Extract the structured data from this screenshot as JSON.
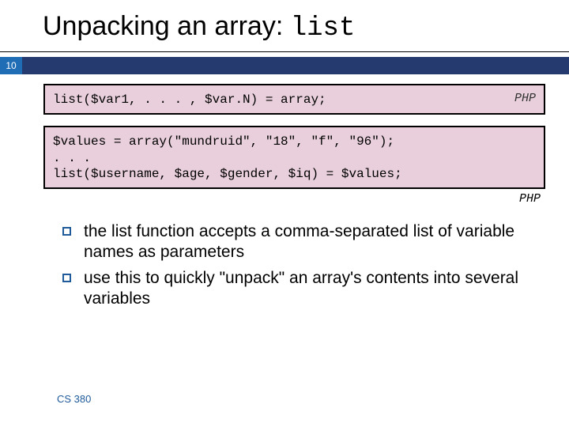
{
  "slide": {
    "title_plain": "Unpacking an array: ",
    "title_code": "list",
    "page_number": "10"
  },
  "code1": {
    "text": "list($var1, . . . , $var.N) = array;",
    "lang": "PHP"
  },
  "code2": {
    "text": "$values = array(\"mundruid\", \"18\", \"f\", \"96\");\n. . .\nlist($username, $age, $gender, $iq) = $values;",
    "lang": "PHP"
  },
  "bullets": [
    "the list function accepts a comma-separated list of variable names as parameters",
    "use this to quickly \"unpack\" an array's contents into several variables"
  ],
  "footer": "CS 380"
}
